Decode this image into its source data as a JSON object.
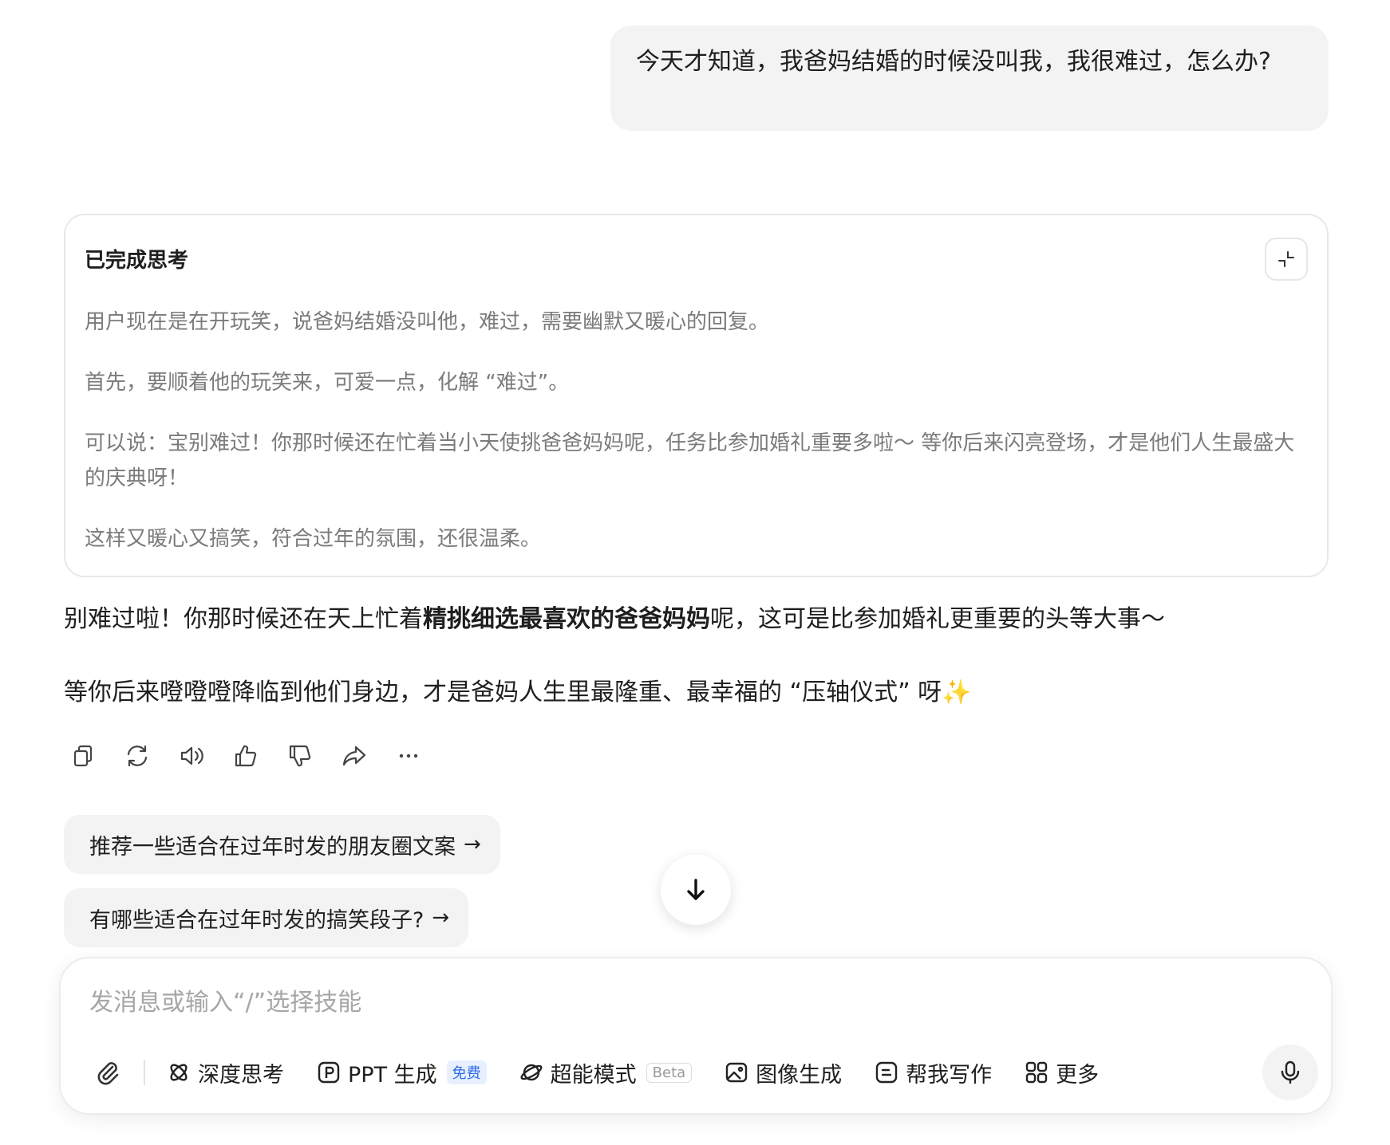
{
  "user_message": "今天才知道，我爸妈结婚的时候没叫我，我很难过，怎么办?",
  "thinking": {
    "title": "已完成思考",
    "collapse_icon": "collapse-icon",
    "paragraphs": [
      "用户现在是在开玩笑，说爸妈结婚没叫他，难过，需要幽默又暖心的回复。",
      "首先，要顺着他的玩笑来，可爱一点，化解 “难过”。",
      "可以说：宝别难过！你那时候还在忙着当小天使挑爸爸妈妈呢，任务比参加婚礼重要多啦～ 等你后来闪亮登场，才是他们人生最盛大的庆典呀！",
      "这样又暖心又搞笑，符合过年的氛围，还很温柔。"
    ]
  },
  "answer": {
    "p1_before": "别难过啦！你那时候还在天上忙着",
    "p1_bold": "精挑细选最喜欢的爸爸妈妈",
    "p1_after": "呢，这可是比参加婚礼更重要的头等大事～",
    "p2": "等你后来噔噔噔降临到他们身边，才是爸妈人生里最隆重、最幸福的 “压轴仪式” 呀",
    "p2_emoji": "✨"
  },
  "actions": [
    "copy-icon",
    "regenerate-icon",
    "read-aloud-icon",
    "thumbs-up-icon",
    "thumbs-down-icon",
    "share-icon",
    "more-icon"
  ],
  "suggestions": [
    {
      "label": "推荐一些适合在过年时发的朋友圈文案",
      "arrow": "→"
    },
    {
      "label": "有哪些适合在过年时发的搞笑段子?",
      "arrow": "→"
    }
  ],
  "composer": {
    "placeholder": "发消息或输入“/”选择技能",
    "value": "",
    "tools": {
      "deep_think": "深度思考",
      "ppt": "PPT 生成",
      "ppt_badge": "免费",
      "super_mode": "超能模式",
      "super_badge": "Beta",
      "image_gen": "图像生成",
      "write": "帮我写作",
      "more": "更多"
    }
  },
  "colors": {
    "bubble_bg": "#f3f3f3",
    "muted_text": "#7b7b7b",
    "accent_blue": "#2f6bea",
    "sparkle": "#f2c94c"
  }
}
